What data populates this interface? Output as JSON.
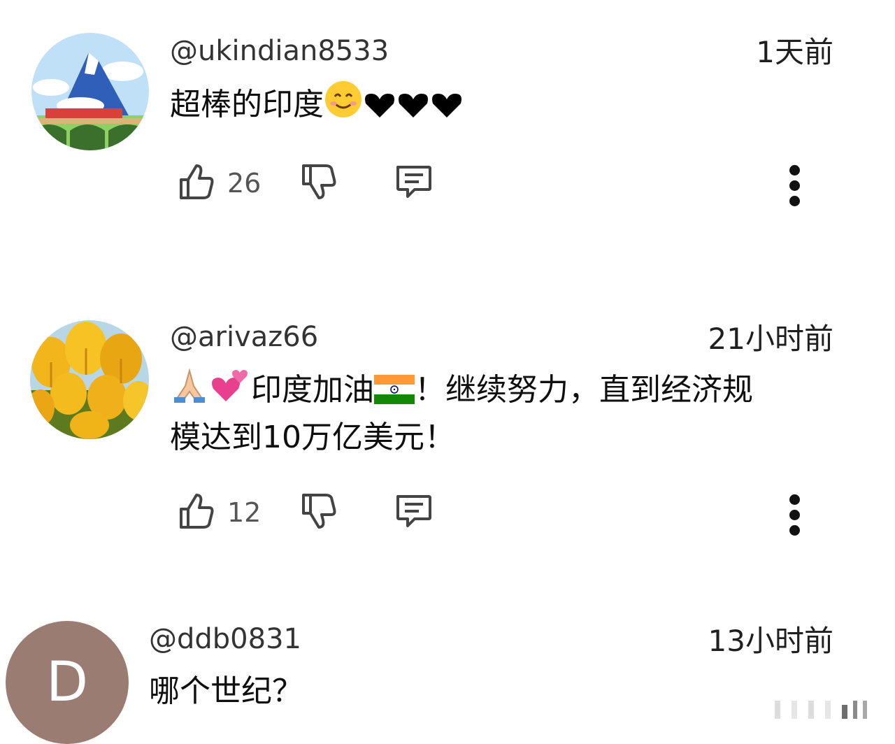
{
  "comments": [
    {
      "handle": "@ukindian8533",
      "time": "1天前",
      "text": "超棒的印度",
      "likes": "26"
    },
    {
      "handle": "@arivaz66",
      "time": "21小时前",
      "text_line1": "印度加油",
      "text_line1_tail": "！继续努力，直到经济规",
      "text_line2": "模达到10万亿美元！",
      "likes": "12"
    },
    {
      "handle": "@ddb0831",
      "time": "13小时前",
      "avatar_letter": "D",
      "text": "哪个世纪？"
    }
  ],
  "icons": {
    "like": "thumbs-up-icon",
    "dislike": "thumbs-down-icon",
    "reply": "reply-comment-icon",
    "more": "more-vertical-icon"
  },
  "colors": {
    "letter_avatar_bg": "#9a7c72",
    "count_text": "#555555"
  }
}
